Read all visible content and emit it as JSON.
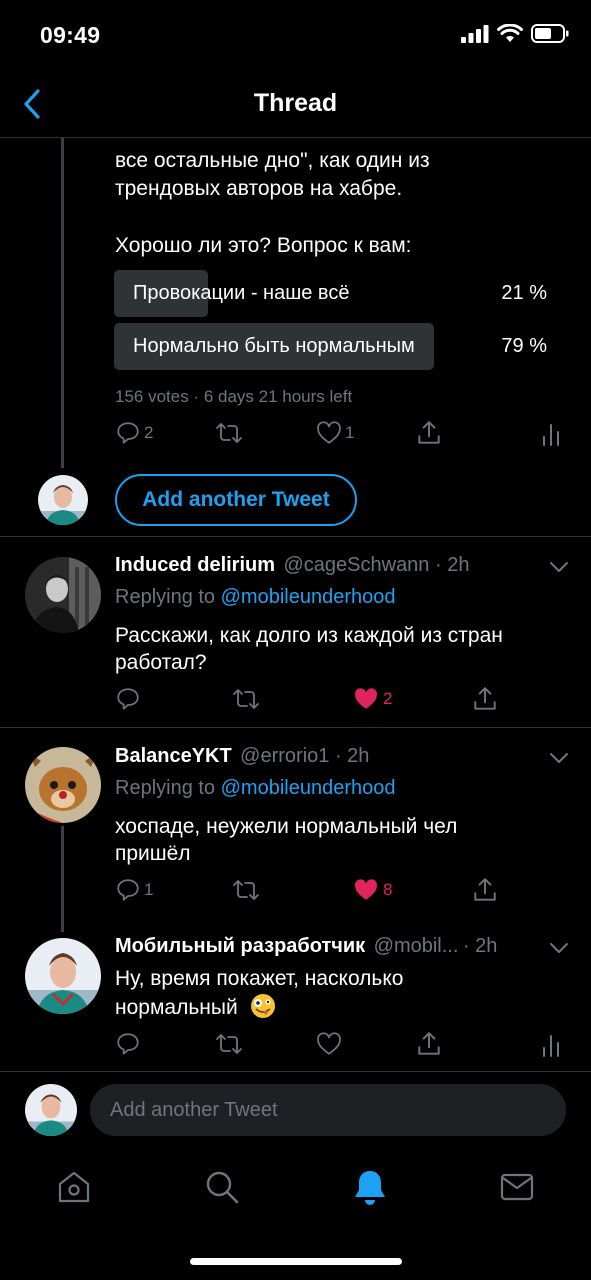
{
  "status_bar": {
    "time": "09:49"
  },
  "nav": {
    "title": "Thread"
  },
  "main_tweet": {
    "text_line_1": "все остальные дно\", как один из",
    "text_line_2": "трендовых авторов на хабре.",
    "question": "Хорошо ли это? Вопрос к вам:",
    "poll": {
      "options": [
        {
          "label": "Провокации - наше всё",
          "percent": "21 %",
          "share": 0.21
        },
        {
          "label": "Нормально быть нормальным",
          "percent": "79 %",
          "share": 0.79
        }
      ],
      "meta": "156 votes · 6 days 21 hours left"
    },
    "reply_count": "2",
    "like_count": "1"
  },
  "add_tweet_button": "Add another Tweet",
  "replies": [
    {
      "name": "Induced delirium",
      "handle_time": "@cageSchwann · 2h",
      "replying_prefix": "Replying to",
      "replying_handle": "@mobileunderhood",
      "text_line_1": "Расскажи, как долго из каждой из стран",
      "text_line_2": "работал?",
      "like_count": "2"
    },
    {
      "name": "BalanceYKT",
      "handle_time": "@errorio1 · 2h",
      "replying_prefix": "Replying to",
      "replying_handle": "@mobileunderhood",
      "text_line_1": "хоспаде, неужели нормальный чел",
      "text_line_2": "пришёл",
      "reply_count": "1",
      "like_count": "8"
    },
    {
      "name": "Мобильный разработчик",
      "handle": "@mobil...",
      "time": "· 2h",
      "text_line_1": "Ну, время покажет, насколько",
      "text_line_2": "нормальный",
      "emoji": "🤪"
    }
  ],
  "compose": {
    "placeholder": "Add another Tweet"
  },
  "colors": {
    "accent": "#1da1f2",
    "like": "#e0245e",
    "muted": "#6e767d",
    "poll_bar": "#2f3336"
  },
  "tab_bar": {
    "items": [
      "home-icon",
      "search-icon",
      "notifications-icon",
      "messages-icon"
    ],
    "active": "notifications-icon"
  }
}
